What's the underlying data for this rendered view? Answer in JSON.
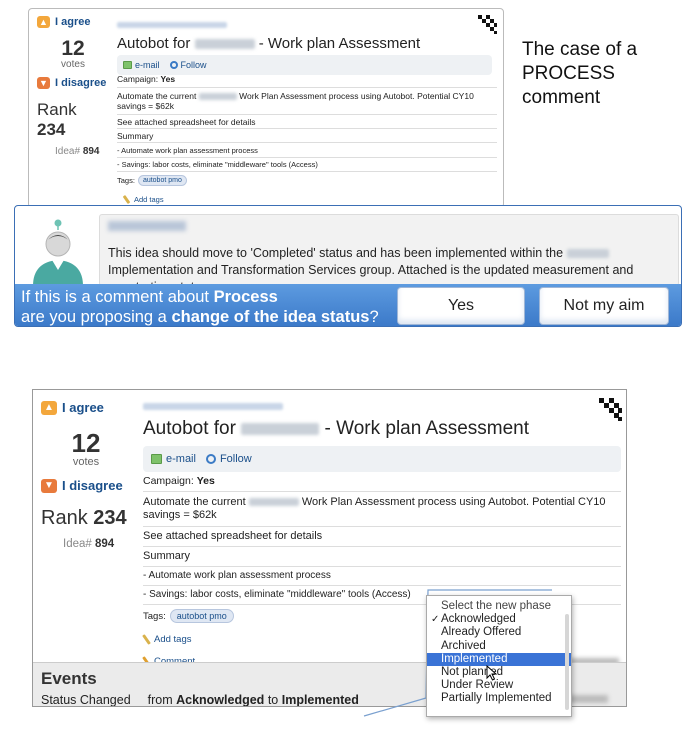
{
  "caption": {
    "line1": "The case of a",
    "line2": "PROCESS",
    "line3": "comment"
  },
  "idea": {
    "agree_label": "I agree",
    "votes": "12",
    "votes_label": "votes",
    "disagree_label": "I disagree",
    "rank_label": "Rank",
    "rank_value": "234",
    "idea_no_label": "Idea#",
    "idea_no_value": "894",
    "title_prefix": "Autobot for",
    "title_suffix": "- Work plan Assessment",
    "email_label": "e-mail",
    "follow_label": "Follow",
    "campaign_label": "Campaign:",
    "campaign_value": "Yes",
    "description_prefix": "Automate the current",
    "description_suffix": "Work Plan Assessment process using Autobot. Potential CY10 savings = $62k",
    "attachment_note": "See attached spreadsheet for details",
    "summary_heading": "Summary",
    "summary_items": [
      "- Automate work plan assessment process",
      "- Savings: labor costs, eliminate \"middleware\" tools (Access)"
    ],
    "tags_label": "Tags:",
    "tag": "autobot pmo",
    "add_tags_label": "Add tags",
    "comment_label": "Comment"
  },
  "comment": {
    "text_part1": "This idea should move to 'Completed' status and has been implemented within the",
    "text_part2": "Implementation and Transformation Services group. Attached is the updated measurement and penetration status."
  },
  "prompt": {
    "line1_pre": "If this is a comment about ",
    "line1_bold": "Process",
    "line2_pre": "are you proposing a ",
    "line2_bold": "change of the idea status",
    "line2_post": "?",
    "yes_label": "Yes",
    "notaim_label": "Not my aim"
  },
  "events": {
    "title": "Events",
    "row_label": "Status Changed",
    "from_word": "from",
    "from_status": "Acknowledged",
    "to_word": "to",
    "to_status": "Implemented"
  },
  "status_dropdown": {
    "header": "Select the new phase",
    "options": [
      "Acknowledged",
      "Already Offered",
      "Archived",
      "Implemented",
      "Not planned",
      "Under Review",
      "Partially Implemented"
    ],
    "checked": "Acknowledged",
    "highlighted": "Implemented"
  },
  "colors": {
    "accent_blue": "#3a78c8",
    "link_blue": "#1a4f8a",
    "highlight": "#3a73d6"
  }
}
